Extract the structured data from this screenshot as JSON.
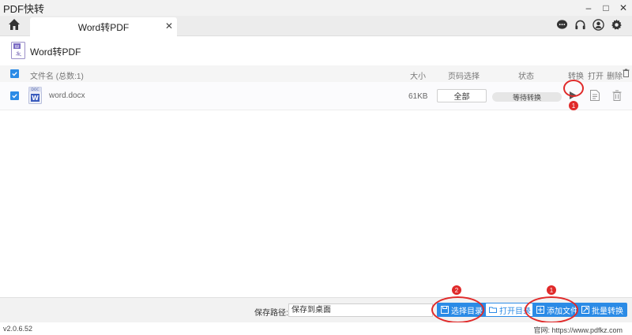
{
  "window": {
    "title": "PDF快转",
    "minimize": "–",
    "maximize": "□",
    "close": "✕"
  },
  "tabbar": {
    "tab_label": "Word转PDF",
    "tab_close": "✕"
  },
  "page": {
    "title": "Word转PDF"
  },
  "table": {
    "header": {
      "filename": "文件名 (总数:1)",
      "size": "大小",
      "page_select": "页码选择",
      "status": "状态",
      "convert": "转换",
      "open": "打开",
      "delete": "删除"
    },
    "rows": [
      {
        "filename": "word.docx",
        "size": "61KB",
        "page_select": "全部",
        "status": "等待转换",
        "file_icon_label_top": "DOC",
        "file_icon_label": "W"
      }
    ]
  },
  "annotations": {
    "marker_1": "1",
    "marker_2": "2",
    "marker_3": "1"
  },
  "bottom": {
    "save_path_label": "保存路径:",
    "save_path_value": "保存到桌面",
    "choose_dir": "选择目录",
    "open_dir": "打开目录",
    "add_file": "添加文件",
    "batch_convert": "批量转换"
  },
  "footer": {
    "version": "v2.0.6.52",
    "website": "官网: https://www.pdfkz.com"
  },
  "colors": {
    "accent": "#2b8be6",
    "annotation_red": "#e02a2a"
  }
}
